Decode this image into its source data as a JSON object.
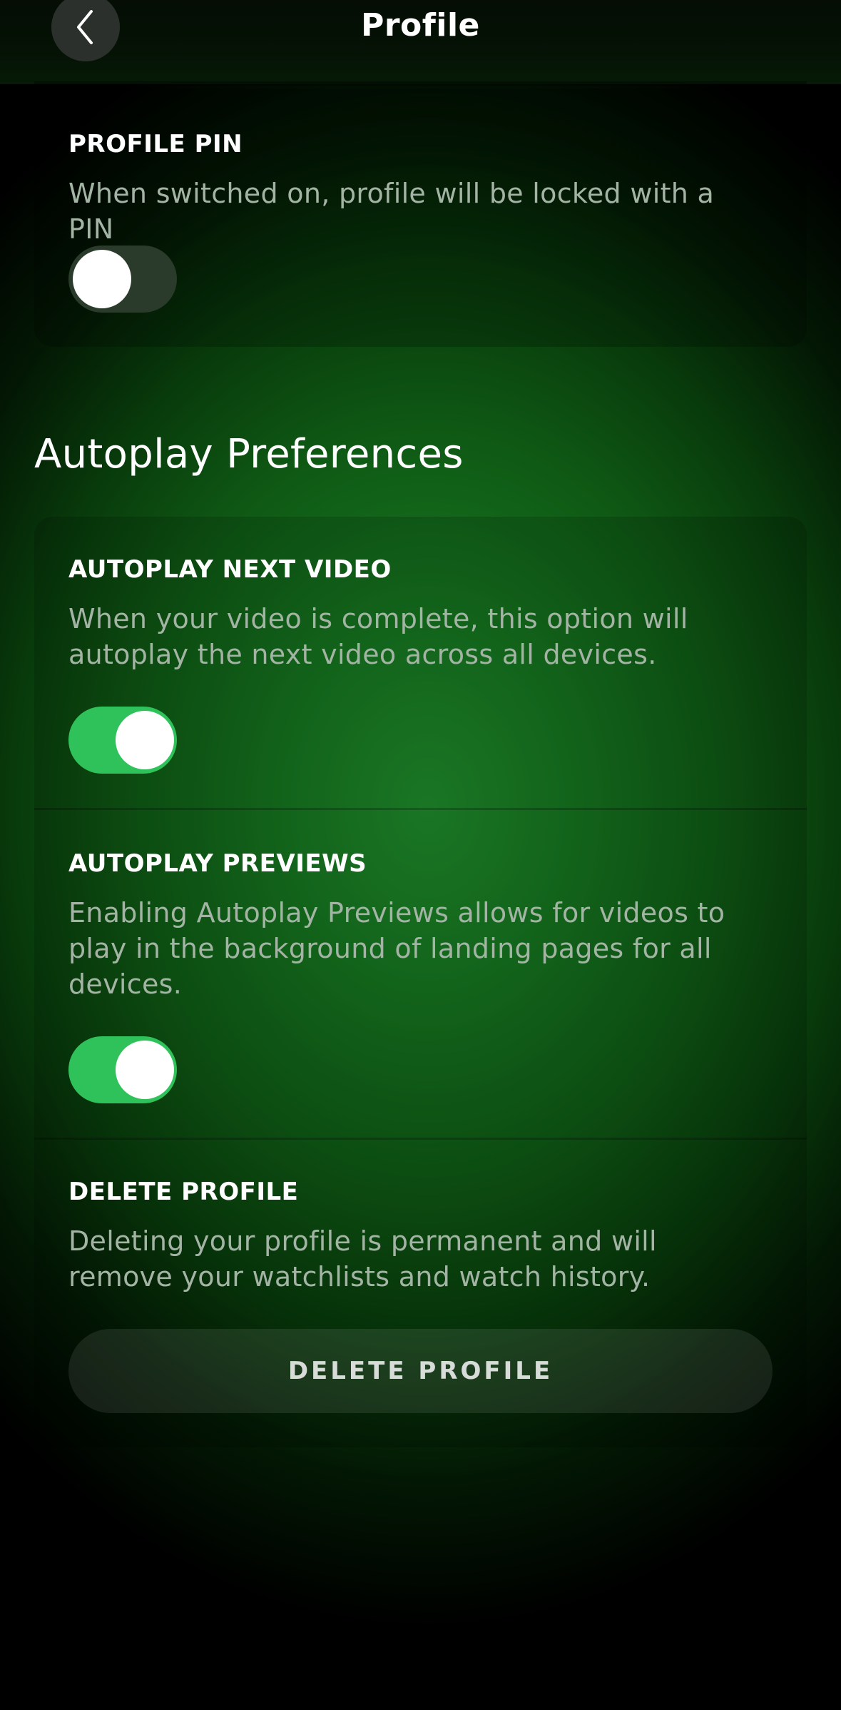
{
  "header": {
    "title": "Profile",
    "back_icon": "chevron-left-icon"
  },
  "profile_pin": {
    "title": "PROFILE PIN",
    "description": "When switched on, profile will be locked with a PIN",
    "enabled": false
  },
  "autoplay": {
    "heading": "Autoplay Preferences",
    "next_video": {
      "title": "AUTOPLAY NEXT VIDEO",
      "description": "When your video is complete, this option will autoplay the next video across all devices.",
      "enabled": true
    },
    "previews": {
      "title": "AUTOPLAY PREVIEWS",
      "description": "Enabling Autoplay Previews allows for videos to play in the background of landing pages for all devices.",
      "enabled": true
    }
  },
  "delete_profile": {
    "title": "DELETE PROFILE",
    "description": "Deleting your profile is permanent and will remove your watchlists and watch history.",
    "button_label": "DELETE PROFILE"
  },
  "colors": {
    "toggle_on": "#30c25a",
    "toggle_off": "#2a3a2b",
    "description_text": "#a3b3a4",
    "background_accent": "#1f8a2b"
  }
}
